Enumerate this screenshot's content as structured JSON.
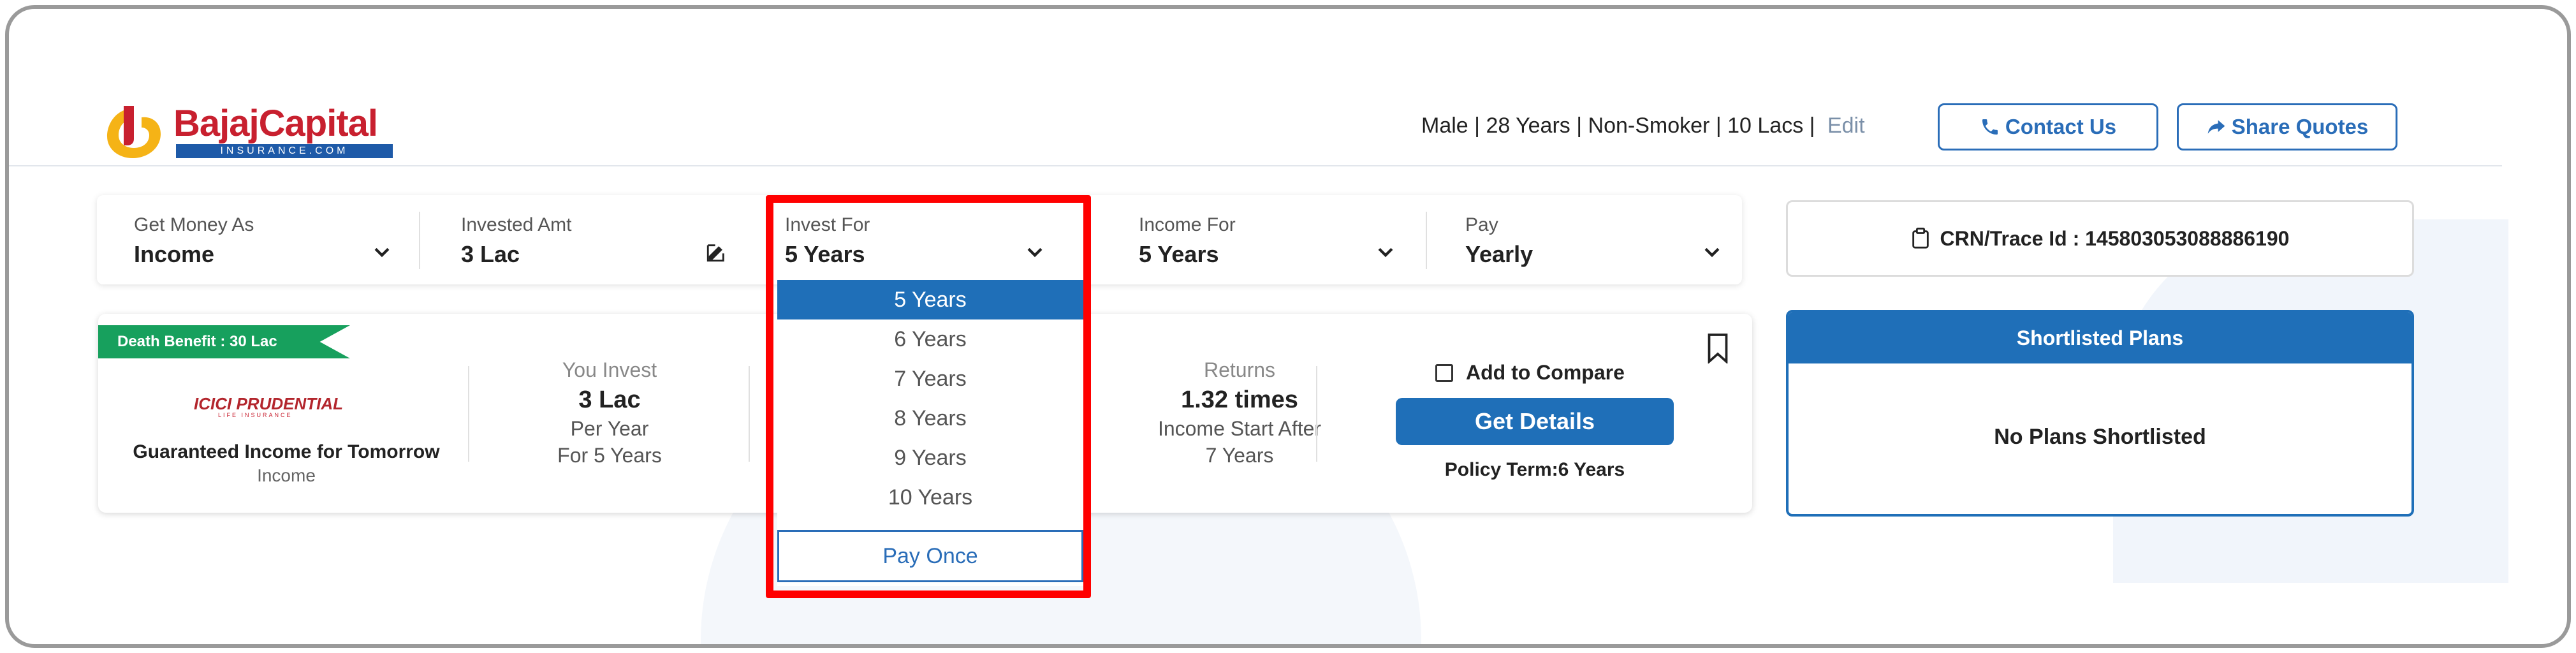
{
  "brand": {
    "name": "BajajCapital",
    "sub": "INSURANCE.COM"
  },
  "profile": {
    "gender": "Male |",
    "age": "28 Years |",
    "smoker": "Non-Smoker |",
    "cover": "10 Lacs |",
    "edit": "Edit"
  },
  "header": {
    "contact_label": "Contact Us",
    "share_label": "Share Quotes"
  },
  "filters": {
    "get_money_as": {
      "label": "Get Money As",
      "value": "Income"
    },
    "invested_amt": {
      "label": "Invested Amt",
      "value": "3 Lac"
    },
    "invest_for": {
      "label": "Invest For",
      "value": "5 Years"
    },
    "income_for": {
      "label": "Income For",
      "value": "5 Years"
    },
    "pay": {
      "label": "Pay",
      "value": "Yearly"
    }
  },
  "dropdown": {
    "options": [
      "5 Years",
      "6 Years",
      "7 Years",
      "8 Years",
      "9 Years",
      "10 Years"
    ],
    "selected_index": 0,
    "pay_once": "Pay Once"
  },
  "plan": {
    "ribbon": "Death Benefit : 30 Lac",
    "insurer": "ICICI PRUDENTIAL",
    "insurer_sub": "LIFE INSURANCE",
    "name": "Guaranteed Income for Tomorrow",
    "type": "Income",
    "invest": {
      "label": "You Invest",
      "value": "3 Lac",
      "line1": "Per Year",
      "line2": "For 5 Years"
    },
    "returns": {
      "label": "Returns",
      "value": "1.32 times",
      "line1": "Income Start After",
      "line2": "7 Years"
    },
    "compare_label": "Add to Compare",
    "details_label": "Get Details",
    "term": "Policy Term:6 Years"
  },
  "crn": {
    "text": "CRN/Trace Id : 145803053088886190"
  },
  "shortlist": {
    "title": "Shortlisted Plans",
    "empty": "No Plans Shortlisted"
  },
  "colors": {
    "primary": "#1f6fb8",
    "brand_red": "#c8202f",
    "ribbon_green": "#17a05d",
    "highlight": "#ff0000"
  }
}
